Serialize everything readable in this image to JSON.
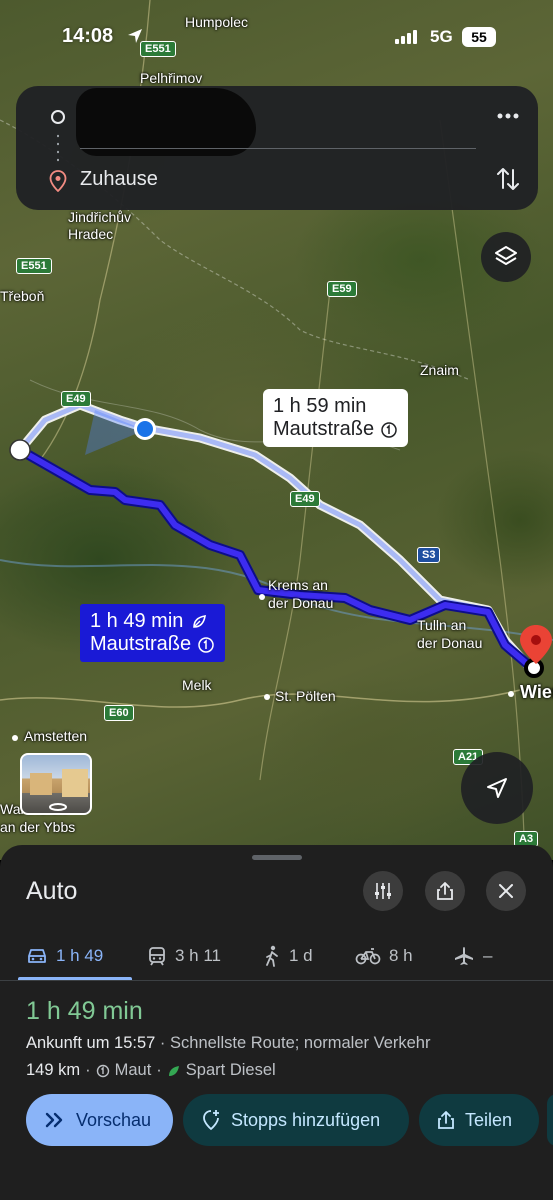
{
  "status_bar": {
    "time": "14:08",
    "network": "5G",
    "battery": "55"
  },
  "route_card": {
    "origin": "",
    "destination": "Zuhause"
  },
  "map": {
    "places": [
      "Humpolec",
      "Pelhřimov",
      "Jindřichův",
      "Hradec",
      "Třeboň",
      "Znaim",
      "Krems an",
      "der Donau",
      "Tulln an",
      "der Donau",
      "Melk",
      "St. Pölten",
      "Amstetten",
      "Waidhofen",
      "an der Ybbs",
      "Wien"
    ],
    "roads": [
      "E551",
      "E551",
      "E59",
      "E49",
      "E49",
      "S3",
      "E60",
      "A21",
      "A3"
    ],
    "alt_route": {
      "time": "1 h 59 min",
      "toll": "Mautstraße"
    },
    "main_route": {
      "time": "1 h 49 min",
      "toll": "Mautstraße"
    }
  },
  "sheet": {
    "title": "Auto",
    "modes": [
      {
        "icon": "car-icon",
        "label": "1 h 49"
      },
      {
        "icon": "train-icon",
        "label": "3 h 11"
      },
      {
        "icon": "walk-icon",
        "label": "1 d"
      },
      {
        "icon": "bike-icon",
        "label": "8 h"
      },
      {
        "icon": "plane-icon",
        "label": "–"
      }
    ],
    "eta": "1 h 49 min",
    "arrival_label": "Ankunft um 15:57",
    "route_note": " · Schnellste Route; normaler Verkehr",
    "distance": "149 km",
    "toll": "Maut",
    "eco": "Spart Diesel",
    "buttons": {
      "preview": "Vorschau",
      "add_stops": "Stopps hinzufügen",
      "share": "Teilen"
    }
  },
  "colors": {
    "main_route": "#1a1ad6",
    "accent": "#8ab4f8",
    "eta_green": "#81c995",
    "pin_red": "#ea4335"
  }
}
